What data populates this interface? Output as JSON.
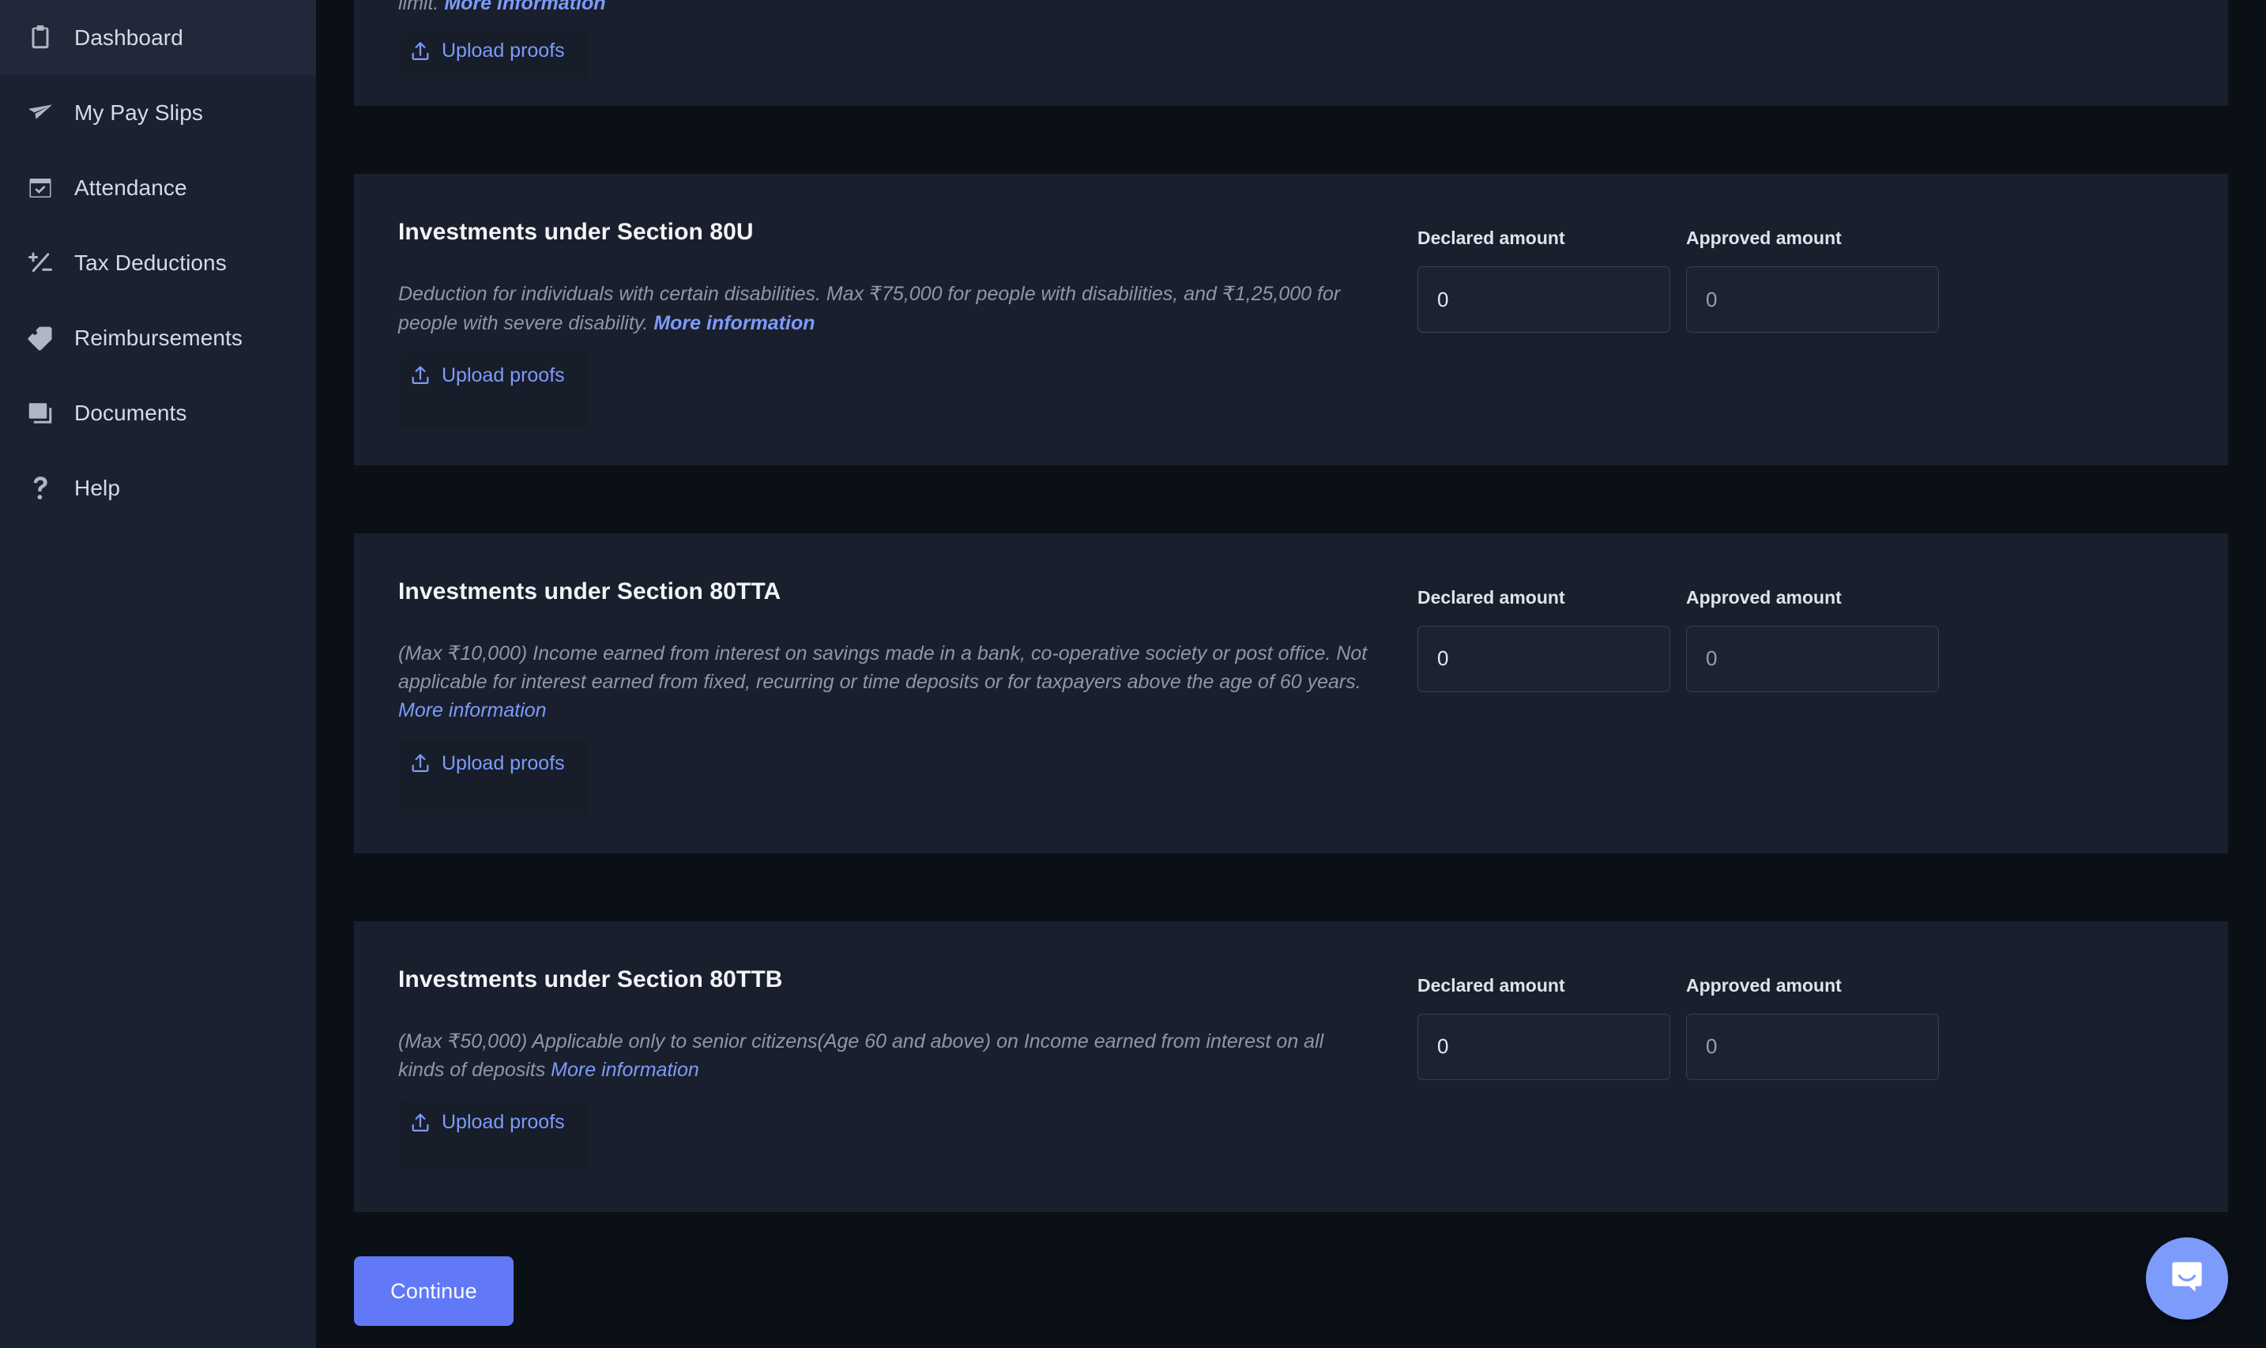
{
  "theme": {
    "page_bg": "#0b1017",
    "sidebar_bg": "#1a2130",
    "card_bg": "#191f2c",
    "accent": "#6179f7",
    "link": "#7d9bfb",
    "input_border": "#39404f"
  },
  "sidebar": {
    "items": [
      {
        "label": "Dashboard",
        "icon": "clipboard-icon"
      },
      {
        "label": "My Pay Slips",
        "icon": "paper-plane-icon"
      },
      {
        "label": "Attendance",
        "icon": "calendar-check-icon"
      },
      {
        "label": "Tax Deductions",
        "icon": "plus-minus-icon"
      },
      {
        "label": "Reimbursements",
        "icon": "tag-icon"
      },
      {
        "label": "Documents",
        "icon": "documents-icon"
      },
      {
        "label": "Help",
        "icon": "question-mark-icon"
      }
    ]
  },
  "labels": {
    "declared_amount": "Declared amount",
    "approved_amount": "Approved amount",
    "upload_proofs": "Upload proofs",
    "more_information": "More information"
  },
  "partial_card": {
    "desc_tail": "limit.",
    "more_info": "More information",
    "upload_label": "Upload proofs"
  },
  "cards": [
    {
      "id": "section-80u",
      "title": "Investments under Section 80U",
      "description": "Deduction for individuals with certain disabilities. Max ₹75,000 for people with disabilities, and ₹1,25,000 for people with severe disability.",
      "more_info": "More information",
      "upload_label": "Upload proofs",
      "declared_label": "Declared amount",
      "approved_label": "Approved amount",
      "declared_value": "0",
      "approved_value": "0"
    },
    {
      "id": "section-80tta",
      "title": "Investments under Section 80TTA",
      "description": "(Max ₹10,000) Income earned from interest on savings made in a bank, co-operative society or post office. Not applicable for interest earned from fixed, recurring or time deposits or for taxpayers above the age of 60 years.",
      "more_info": "More information",
      "upload_label": "Upload proofs",
      "declared_label": "Declared amount",
      "approved_label": "Approved amount",
      "declared_value": "0",
      "approved_value": "0"
    },
    {
      "id": "section-80ttb",
      "title": "Investments under Section 80TTB",
      "description": "(Max ₹50,000) Applicable only to senior citizens(Age 60 and above) on Income earned from interest on all kinds of deposits",
      "more_info": "More information",
      "upload_label": "Upload proofs",
      "declared_label": "Declared amount",
      "approved_label": "Approved amount",
      "declared_value": "0",
      "approved_value": "0"
    }
  ],
  "footer": {
    "continue_label": "Continue"
  },
  "chat": {
    "icon": "chat-bubble-smile-icon"
  }
}
